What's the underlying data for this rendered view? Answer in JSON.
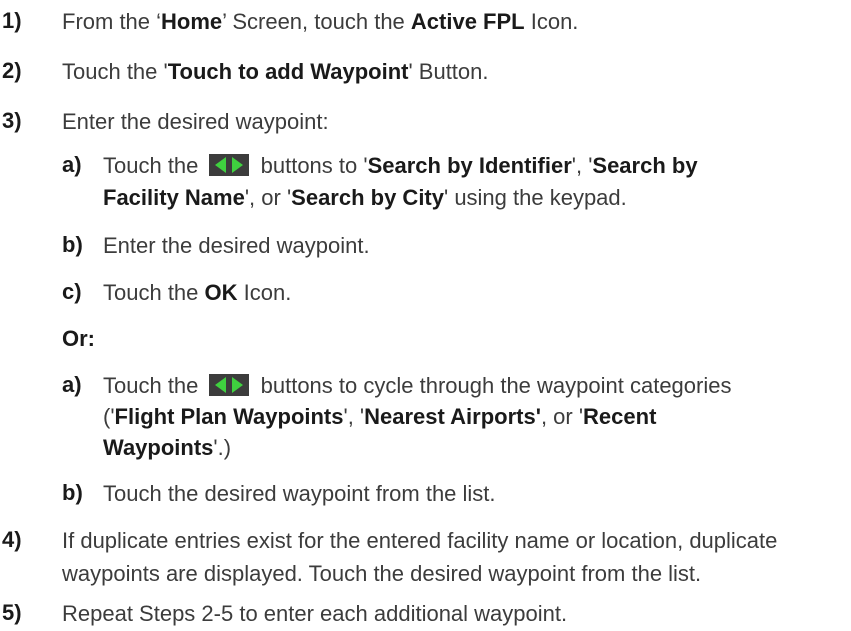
{
  "steps": {
    "s1": {
      "num": "1)",
      "t1": "From the ‘",
      "b1": "Home",
      "t2": "’ Screen, touch the ",
      "b2": "Active FPL",
      "t3": " Icon."
    },
    "s2": {
      "num": "2)",
      "t1": "Touch the '",
      "b1": "Touch to add Waypoint",
      "t2": "' Button."
    },
    "s3": {
      "num": "3)",
      "t1": "Enter the desired waypoint:"
    },
    "s3a": {
      "num": "a)",
      "t1": "Touch the ",
      "t2": " buttons to '",
      "b1": "Search by Identifier",
      "t3": "', '",
      "b2": "Search by",
      "b3": "Facility Name",
      "t4": "', or '",
      "b4": "Search by City",
      "t5": "' using the keypad."
    },
    "s3b": {
      "num": "b)",
      "t1": "Enter the desired waypoint."
    },
    "s3c": {
      "num": "c)",
      "t1": "Touch the ",
      "b1": "OK",
      "t2": " Icon."
    },
    "or": "Or:",
    "s3a2": {
      "num": "a)",
      "t1": "Touch the ",
      "t2": " buttons to cycle through the waypoint categories",
      "t3": "('",
      "b1": "Flight Plan Waypoints",
      "t4": "', '",
      "b2": "Nearest Airports'",
      "t5": ", or '",
      "b3": "Recent",
      "b4": "Waypoints",
      "t6": "'.)"
    },
    "s3b2": {
      "num": "b)",
      "t1": "Touch the desired waypoint from the list."
    },
    "s4": {
      "num": "4)",
      "l1": "If duplicate entries exist for the entered facility name or location, duplicate",
      "l2": "waypoints are displayed.  Touch the desired waypoint from the list."
    },
    "s5": {
      "num": "5)",
      "t1": "Repeat Steps 2-5 to enter each additional waypoint."
    }
  },
  "icons": {
    "arrow_buttons": "left-right-arrows-icon"
  },
  "colors": {
    "arrow": "#3fd13f",
    "arrow_bg": "#3c3c3c",
    "text": "#3c3c3c",
    "bold": "#1a1a1a"
  }
}
